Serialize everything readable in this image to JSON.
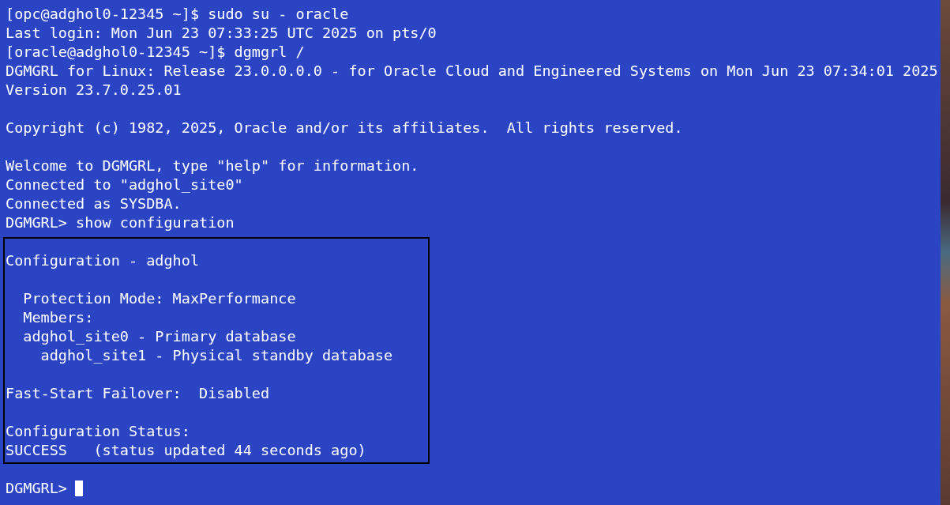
{
  "terminal": {
    "paragraphs": [
      [
        "[opc@adghol0-12345 ~]$ sudo su - oracle",
        "Last login: Mon Jun 23 07:33:25 UTC 2025 on pts/0",
        "[oracle@adghol0-12345 ~]$ dgmgrl /",
        "DGMGRL for Linux: Release 23.0.0.0.0 - for Oracle Cloud and Engineered Systems on Mon Jun 23 07:34:01 2025",
        "Version 23.7.0.25.01"
      ],
      [
        "Copyright (c) 1982, 2025, Oracle and/or its affiliates.  All rights reserved."
      ],
      [
        "Welcome to DGMGRL, type \"help\" for information.",
        "Connected to \"adghol_site0\"",
        "Connected as SYSDBA.",
        "DGMGRL> show configuration"
      ]
    ],
    "highlight_box": {
      "paragraphs": [
        [
          "Configuration - adghol"
        ],
        [
          "  Protection Mode: MaxPerformance",
          "  Members:",
          "  adghol_site0 - Primary database",
          "    adghol_site1 - Physical standby database"
        ],
        [
          "Fast-Start Failover:  Disabled"
        ],
        [
          "Configuration Status:",
          "SUCCESS   (status updated 44 seconds ago)"
        ]
      ]
    },
    "prompt": {
      "text": "DGMGRL>",
      "cursor": true
    }
  }
}
